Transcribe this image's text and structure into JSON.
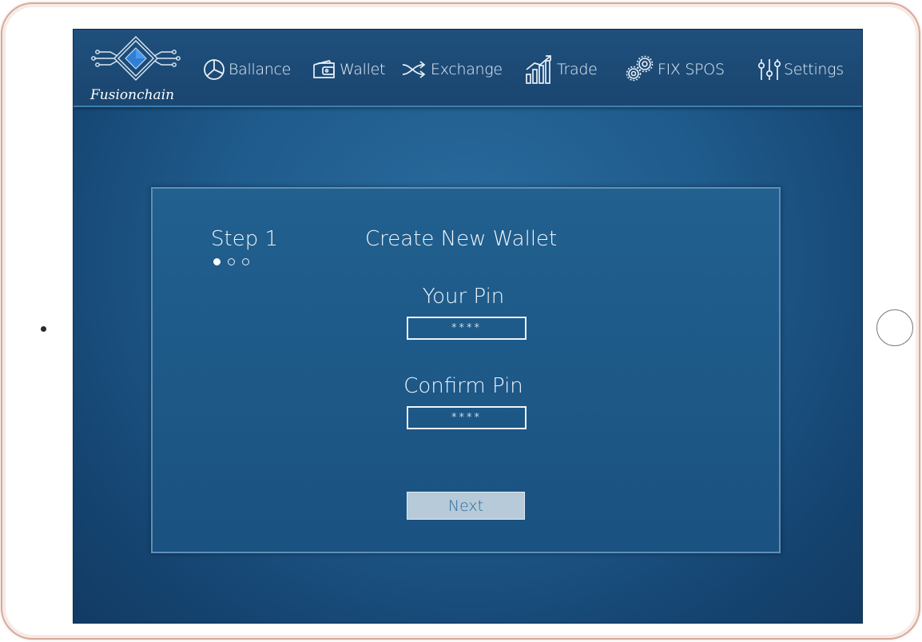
{
  "brand": {
    "name": "Fusionchain"
  },
  "nav": {
    "items": [
      {
        "label": "Ballance",
        "icon": "pie-chart-icon"
      },
      {
        "label": "Wallet",
        "icon": "wallet-icon"
      },
      {
        "label": "Exchange",
        "icon": "shuffle-icon"
      },
      {
        "label": "Trade",
        "icon": "bar-chart-icon"
      },
      {
        "label": "FIX SPOS",
        "icon": "gears-icon"
      },
      {
        "label": "Settings",
        "icon": "sliders-icon"
      }
    ]
  },
  "wizard": {
    "step_label": "Step 1",
    "total_steps": 3,
    "current_step": 1,
    "title": "Create New Wallet",
    "pin": {
      "label": "Your Pin",
      "value": "****"
    },
    "confirm_pin": {
      "label": "Confirm Pin",
      "value": "****"
    },
    "next_label": "Next"
  },
  "colors": {
    "background": "#1f5b8c",
    "topbar": "#1a4670",
    "button": "#b6cad9",
    "button_text": "#2e6b9a",
    "text": "#f0f5fa",
    "logo_accent": "#2f7fd6"
  }
}
